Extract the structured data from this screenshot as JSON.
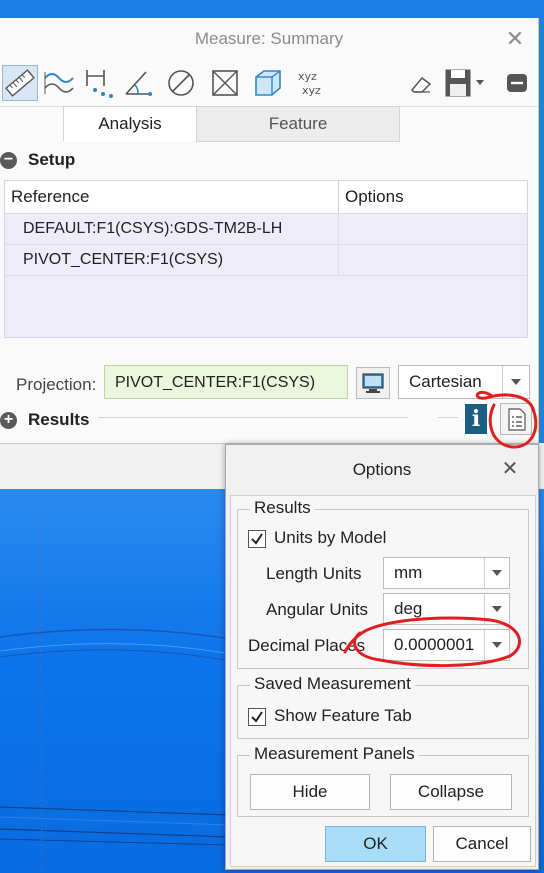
{
  "colors": {
    "viewport_blue": "#1f7fe8",
    "projection_green": "#eaf7dd",
    "ok_blue": "#a9dcf7",
    "annotation_red": "#e0201f",
    "info_teal": "#1d5f82"
  },
  "measure": {
    "title": "Measure: Summary",
    "close_icon": "close-icon",
    "toolbar": {
      "tools": [
        "ruler-icon",
        "curve-length-icon",
        "distance-icon",
        "angle-icon",
        "diameter-icon",
        "area-icon",
        "volume-icon",
        "transform-icon"
      ],
      "right_tools": [
        "eraser-icon",
        "save-icon",
        "collapse-icon"
      ]
    },
    "tabs": {
      "analysis": "Analysis",
      "feature": "Feature"
    },
    "setup": {
      "label": "Setup",
      "table": {
        "columns": [
          "Reference",
          "Options"
        ],
        "rows": [
          "DEFAULT:F1(CSYS):GDS-TM2B-LH",
          "PIVOT_CENTER:F1(CSYS)"
        ]
      },
      "projection_label": "Projection:",
      "projection_value": "PIVOT_CENTER:F1(CSYS)",
      "coordinate_system": "Cartesian"
    },
    "results": {
      "label": "Results",
      "info_label": "i"
    }
  },
  "options_dialog": {
    "title": "Options",
    "results_group": {
      "title": "Results",
      "units_by_model": {
        "label": "Units by Model",
        "checked": true
      },
      "length_units_label": "Length Units",
      "length_units": "mm",
      "angular_units_label": "Angular Units",
      "angular_units": "deg",
      "decimal_places_label": "Decimal Places",
      "decimal_places": "0.0000001"
    },
    "saved_group": {
      "title": "Saved Measurement",
      "show_feature_tab": {
        "label": "Show Feature Tab",
        "checked": true
      }
    },
    "panels_group": {
      "title": "Measurement Panels",
      "hide": "Hide",
      "collapse": "Collapse"
    },
    "ok": "OK",
    "cancel": "Cancel"
  }
}
